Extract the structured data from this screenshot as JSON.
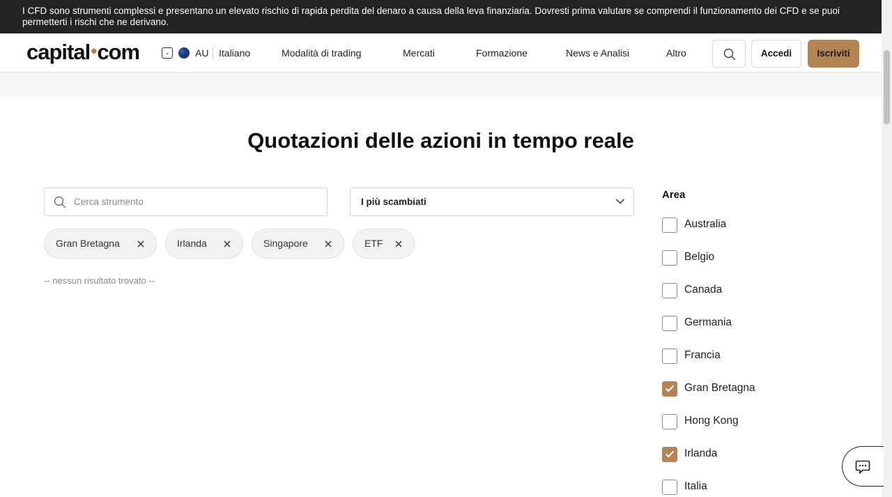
{
  "risk_banner": {
    "text": "I CFD sono strumenti complessi e presentano un elevato rischio di rapida perdita del denaro a causa della leva finanziaria. Dovresti prima valutare se comprendi il funzionamento dei CFD e se puoi permetterti i rischi che ne derivano."
  },
  "header": {
    "logo_left": "capital",
    "logo_dot": "•",
    "logo_right": "com",
    "region_code": "AU",
    "language": "Italiano",
    "nav": [
      "Modalità di trading",
      "Mercati",
      "Formazione",
      "News e Analisi",
      "Altro"
    ],
    "login_label": "Accedi",
    "signup_label": "Iscriviti"
  },
  "main": {
    "title": "Quotazioni delle azioni in tempo reale",
    "search_placeholder": "Cerca strumento",
    "sort_value": "I più scambiati",
    "chips": [
      "Gran Bretagna",
      "Irlanda",
      "Singapore",
      "ETF"
    ],
    "no_results": "-- nessun risultato trovato --"
  },
  "filters": {
    "area_title": "Area",
    "options": [
      {
        "label": "Australia",
        "checked": false
      },
      {
        "label": "Belgio",
        "checked": false
      },
      {
        "label": "Canada",
        "checked": false
      },
      {
        "label": "Germania",
        "checked": false
      },
      {
        "label": "Francia",
        "checked": false
      },
      {
        "label": "Gran Bretagna",
        "checked": true
      },
      {
        "label": "Hong Kong",
        "checked": false
      },
      {
        "label": "Irlanda",
        "checked": true
      },
      {
        "label": "Italia",
        "checked": false
      }
    ]
  },
  "colors": {
    "accent": "#b58454",
    "banner_bg": "#232323"
  }
}
